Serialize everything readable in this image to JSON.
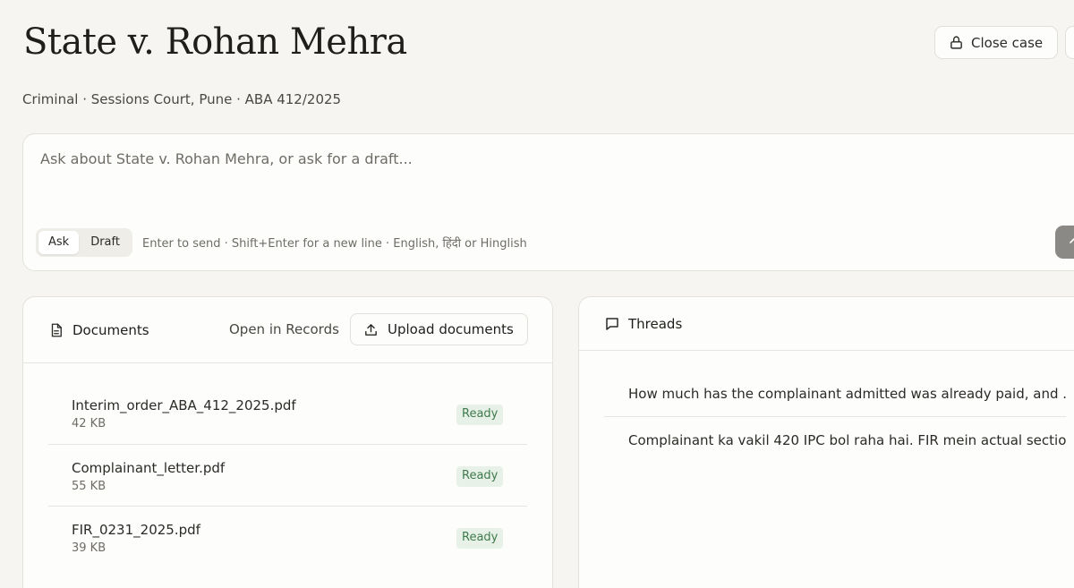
{
  "header": {
    "title": "State v. Rohan Mehra",
    "subtitle": "Criminal · Sessions Court, Pune · ABA 412/2025",
    "close_label": "Close case"
  },
  "composer": {
    "placeholder": "Ask about State v. Rohan Mehra, or ask for a draft...",
    "modes": [
      "Ask",
      "Draft"
    ],
    "active_mode": "Ask",
    "hint": "Enter to send · Shift+Enter for a new line · English, हिंदी or Hinglish"
  },
  "documents": {
    "title": "Documents",
    "open_records_label": "Open in Records",
    "upload_label": "Upload documents",
    "items": [
      {
        "name": "Interim_order_ABA_412_2025.pdf",
        "size": "42 KB",
        "status": "Ready"
      },
      {
        "name": "Complainant_letter.pdf",
        "size": "55 KB",
        "status": "Ready"
      },
      {
        "name": "FIR_0231_2025.pdf",
        "size": "39 KB",
        "status": "Ready"
      }
    ]
  },
  "threads": {
    "title": "Threads",
    "items": [
      "How much has the complainant admitted was already paid, and ...",
      "Complainant ka vakil 420 IPC bol raha hai. FIR mein actual sectio..."
    ]
  },
  "colors": {
    "background": "#f6f5f1",
    "panel": "#fdfdfb",
    "ready_badge_bg": "#e7f1e8",
    "ready_badge_text": "#3f7a4c",
    "send_button": "#8a8985"
  },
  "icons": {
    "close_case": "lock-icon",
    "send": "arrow-up-icon",
    "documents": "document-icon",
    "upload": "upload-icon",
    "threads": "chat-bubble-icon"
  }
}
